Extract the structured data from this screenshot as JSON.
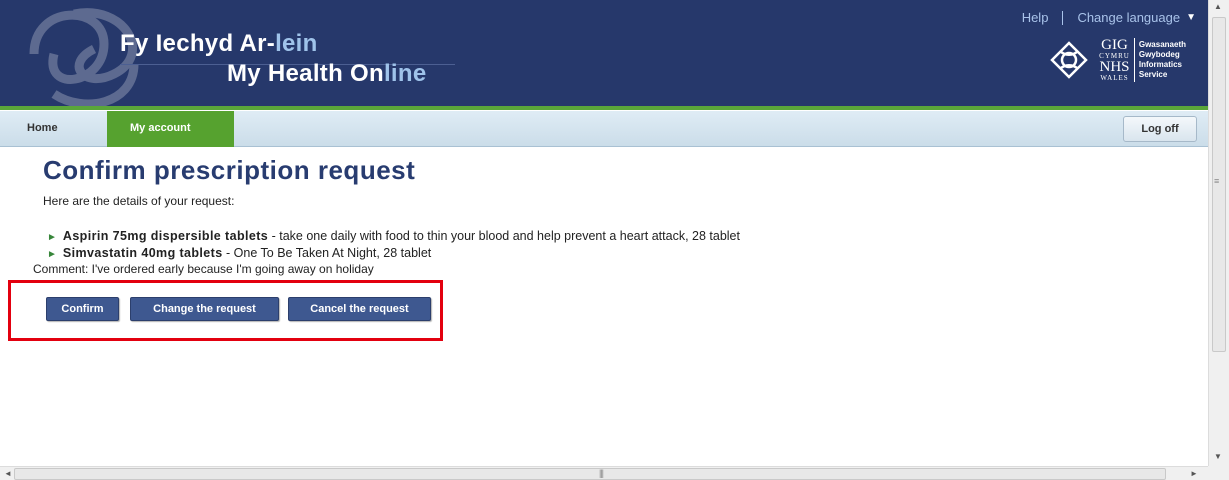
{
  "header": {
    "brand_welsh_main": "Fy Iechyd Ar-",
    "brand_welsh_accent": "lein",
    "brand_english_main": "My Health On",
    "brand_english_accent": "line",
    "help_label": "Help",
    "language_label": "Change language",
    "logo": {
      "welsh_org": "GIG",
      "welsh_country": "CYMRU",
      "english_org": "NHS",
      "english_country": "WALES",
      "service_welsh": [
        "Gwasanaeth",
        "Gwybodeg"
      ],
      "service_english": [
        "Informatics",
        "Service"
      ]
    }
  },
  "nav": {
    "home": "Home",
    "my_account": "My account",
    "log_off": "Log off"
  },
  "main": {
    "title": "Confirm prescription request",
    "intro": "Here are the details of your request:",
    "items": [
      {
        "name": "Aspirin 75mg dispersible tablets",
        "details": " - take one daily with food to thin your blood and help prevent a heart attack, 28 tablet"
      },
      {
        "name": "Simvastatin 40mg tablets",
        "details": " - One To Be Taken At Night, 28 tablet"
      }
    ],
    "comment": "Comment: I've ordered early because I'm going away on holiday",
    "buttons": {
      "confirm": "Confirm",
      "change": "Change the request",
      "cancel": "Cancel the request"
    }
  },
  "colors": {
    "banner": "#26386b",
    "accent_green": "#56a22f",
    "title_blue": "#283c70",
    "button_blue": "#3e5890",
    "highlight_red": "#e3000f"
  }
}
